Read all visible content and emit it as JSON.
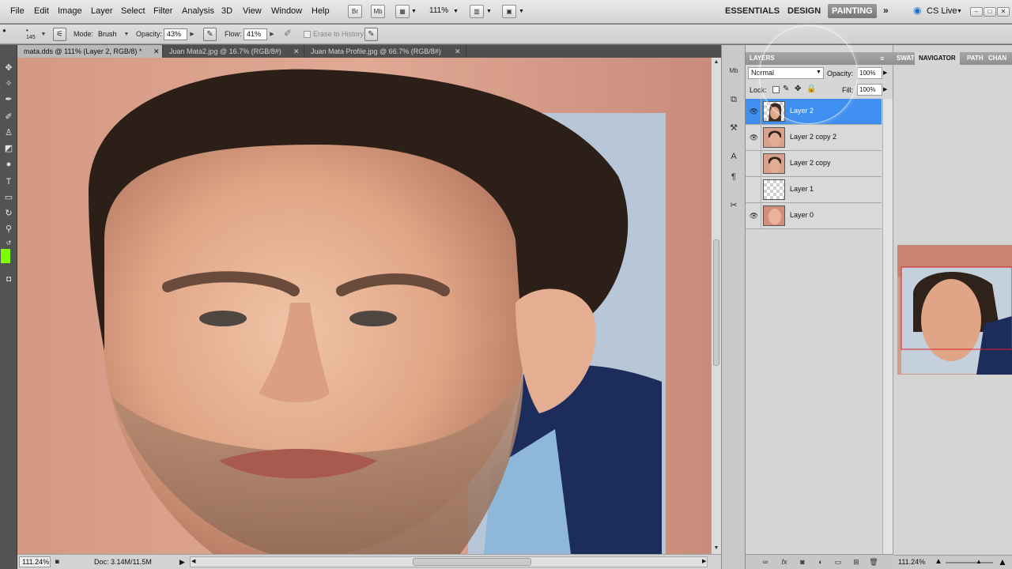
{
  "menubar": {
    "items": [
      "File",
      "Edit",
      "Image",
      "Layer",
      "Select",
      "Filter",
      "Analysis",
      "3D",
      "View",
      "Window",
      "Help"
    ],
    "zoom": "111%",
    "workspaces": [
      "ESSENTIALS",
      "DESIGN",
      "PAINTING"
    ],
    "active_workspace": "PAINTING",
    "cs_live": "CS Live"
  },
  "options": {
    "brush_size": "145",
    "mode_label": "Mode:",
    "mode_value": "Brush",
    "opacity_label": "Opacity:",
    "opacity_value": "43%",
    "flow_label": "Flow:",
    "flow_value": "41%",
    "erase_to_history": "Erase to History"
  },
  "tabs": [
    {
      "label": "mata.dds @ 111% (Layer 2, RGB/8) *"
    },
    {
      "label": "Juan Mata2.jpg @ 16.7% (RGB/8#)"
    },
    {
      "label": "Juan Mata Profile.jpg @ 66.7% (RGB/8#)"
    }
  ],
  "status": {
    "zoom": "111.24%",
    "doc": "Doc: 3.14M/11.5M"
  },
  "layers": {
    "tabs": [
      "LAYERS"
    ],
    "blend_mode": "Normal",
    "opacity_label": "Opacity:",
    "opacity_value": "100%",
    "lock_label": "Lock:",
    "fill_label": "Fill:",
    "fill_value": "100%",
    "items": [
      {
        "name": "Layer 2",
        "visible": true,
        "selected": true
      },
      {
        "name": "Layer 2 copy 2",
        "visible": true,
        "selected": false
      },
      {
        "name": "Layer 2 copy",
        "visible": false,
        "selected": false
      },
      {
        "name": "Layer 1",
        "visible": false,
        "selected": false
      },
      {
        "name": "Layer 0",
        "visible": true,
        "selected": false
      }
    ]
  },
  "navigator": {
    "tabs": [
      "SWAT",
      "NAVIGATOR",
      "PATH",
      "CHAN"
    ],
    "zoom": "111.24%"
  },
  "colors": {
    "selection_blue": "#3f8ff0",
    "skin_bg": "#d79b85",
    "active_workspace_bg": "#8a8a8a"
  }
}
